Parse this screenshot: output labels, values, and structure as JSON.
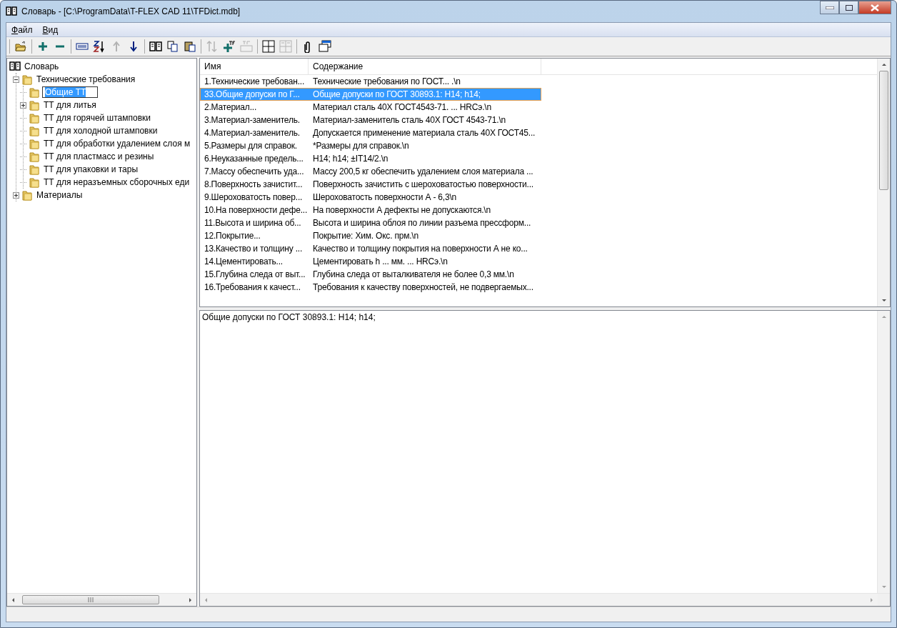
{
  "window": {
    "title": "Словарь - [C:\\ProgramData\\T-FLEX CAD 11\\TFDict.mdb]"
  },
  "menu": [
    {
      "label": "Файл"
    },
    {
      "label": "Вид"
    }
  ],
  "toolbar": [
    [
      {
        "kind": "open",
        "disabled": false
      }
    ],
    [
      {
        "kind": "add",
        "disabled": false
      },
      {
        "kind": "remove",
        "disabled": false
      }
    ],
    [
      {
        "kind": "rename",
        "disabled": false
      },
      {
        "kind": "sort",
        "disabled": false
      },
      {
        "kind": "up",
        "disabled": true
      },
      {
        "kind": "down",
        "disabled": false
      }
    ],
    [
      {
        "kind": "book",
        "disabled": false
      },
      {
        "kind": "copy",
        "disabled": false
      },
      {
        "kind": "paste",
        "disabled": false
      }
    ],
    [
      {
        "kind": "swap",
        "disabled": true
      },
      {
        "kind": "tf-add",
        "disabled": false
      },
      {
        "kind": "tf-rename",
        "disabled": true
      }
    ],
    [
      {
        "kind": "grid",
        "disabled": false
      },
      {
        "kind": "grid-text",
        "disabled": true
      }
    ],
    [
      {
        "kind": "clip",
        "disabled": false
      },
      {
        "kind": "window",
        "disabled": false
      }
    ]
  ],
  "tree": {
    "label": "Словарь",
    "children": [
      {
        "label": "Технические требования",
        "expanded": true,
        "editing": false,
        "children": [
          {
            "label": "Общие ТТ",
            "editing": true
          },
          {
            "label": "ТТ для литья",
            "expanded": false,
            "editing": false
          },
          {
            "label": "ТТ для горячей штамповки",
            "editing": false
          },
          {
            "label": "ТТ для холодной штамповки",
            "editing": false
          },
          {
            "label": "ТТ для обработки удалением слоя м",
            "editing": false
          },
          {
            "label": "ТТ для пластмасс и резины",
            "editing": false
          },
          {
            "label": "ТТ для упаковки и тары",
            "editing": false
          },
          {
            "label": "ТТ для неразъемных сборочных еди",
            "editing": false
          }
        ]
      },
      {
        "label": "Материалы",
        "expanded": false,
        "editing": false
      }
    ]
  },
  "table": {
    "columns": [
      "Имя",
      "Содержание"
    ],
    "rows": [
      {
        "name": "1.Технические требован...",
        "content": "Технические требования по ГОСТ... .\\n",
        "selected": false
      },
      {
        "name": "33.Общие допуски по Г...",
        "content": "Общие допуски по ГОСТ 30893.1: H14; h14;",
        "selected": true
      },
      {
        "name": "2.Материал...",
        "content": "Материал сталь 40Х ГОСТ4543-71. ... HRCэ.\\n",
        "selected": false
      },
      {
        "name": "3.Материал-заменитель.",
        "content": "Материал-заменитель сталь 40Х ГОСТ 4543-71.\\n",
        "selected": false
      },
      {
        "name": "4.Материал-заменитель.",
        "content": "Допускается применение материала сталь 40Х ГОСТ45...",
        "selected": false
      },
      {
        "name": "5.Размеры для справок.",
        "content": "*Размеры для справок.\\n",
        "selected": false
      },
      {
        "name": "6.Неуказанные предель...",
        "content": "H14; h14; ±IT14/2.\\n",
        "selected": false
      },
      {
        "name": "7.Массу обеспечить уда...",
        "content": "Массу 200,5 кг обеспечить удалением слоя материала ...",
        "selected": false
      },
      {
        "name": "8.Поверхность зачистит...",
        "content": "Поверхность зачистить с шероховатостью поверхности...",
        "selected": false
      },
      {
        "name": "9.Шероховатость повер...",
        "content": "Шероховатость поверхности А - 6,3\\n",
        "selected": false
      },
      {
        "name": "10.На поверхности дефе...",
        "content": "На поверхности А дефекты не допускаются.\\n",
        "selected": false
      },
      {
        "name": "11.Высота и ширина об...",
        "content": "Высота и ширина облоя по линии разъема прессформ...",
        "selected": false
      },
      {
        "name": "12.Покрытие...",
        "content": "Покрытие: Хим. Окс. прм.\\n",
        "selected": false
      },
      {
        "name": "13.Качество и толщину ...",
        "content": "Качество и толщину покрытия на поверхности А не ко...",
        "selected": false
      },
      {
        "name": "14.Цементировать...",
        "content": "Цементировать h ...  мм. ...  HRCэ.\\n",
        "selected": false
      },
      {
        "name": "15.Глубина следа от выт...",
        "content": "Глубина следа от выталкивателя не более 0,3 мм.\\n",
        "selected": false
      },
      {
        "name": "16.Требования к качест...",
        "content": "Требования к качеству поверхностей, не подвергаемых...",
        "selected": false
      }
    ]
  },
  "detail": {
    "text": "Общие допуски по ГОСТ 30893.1: H14; h14;"
  }
}
